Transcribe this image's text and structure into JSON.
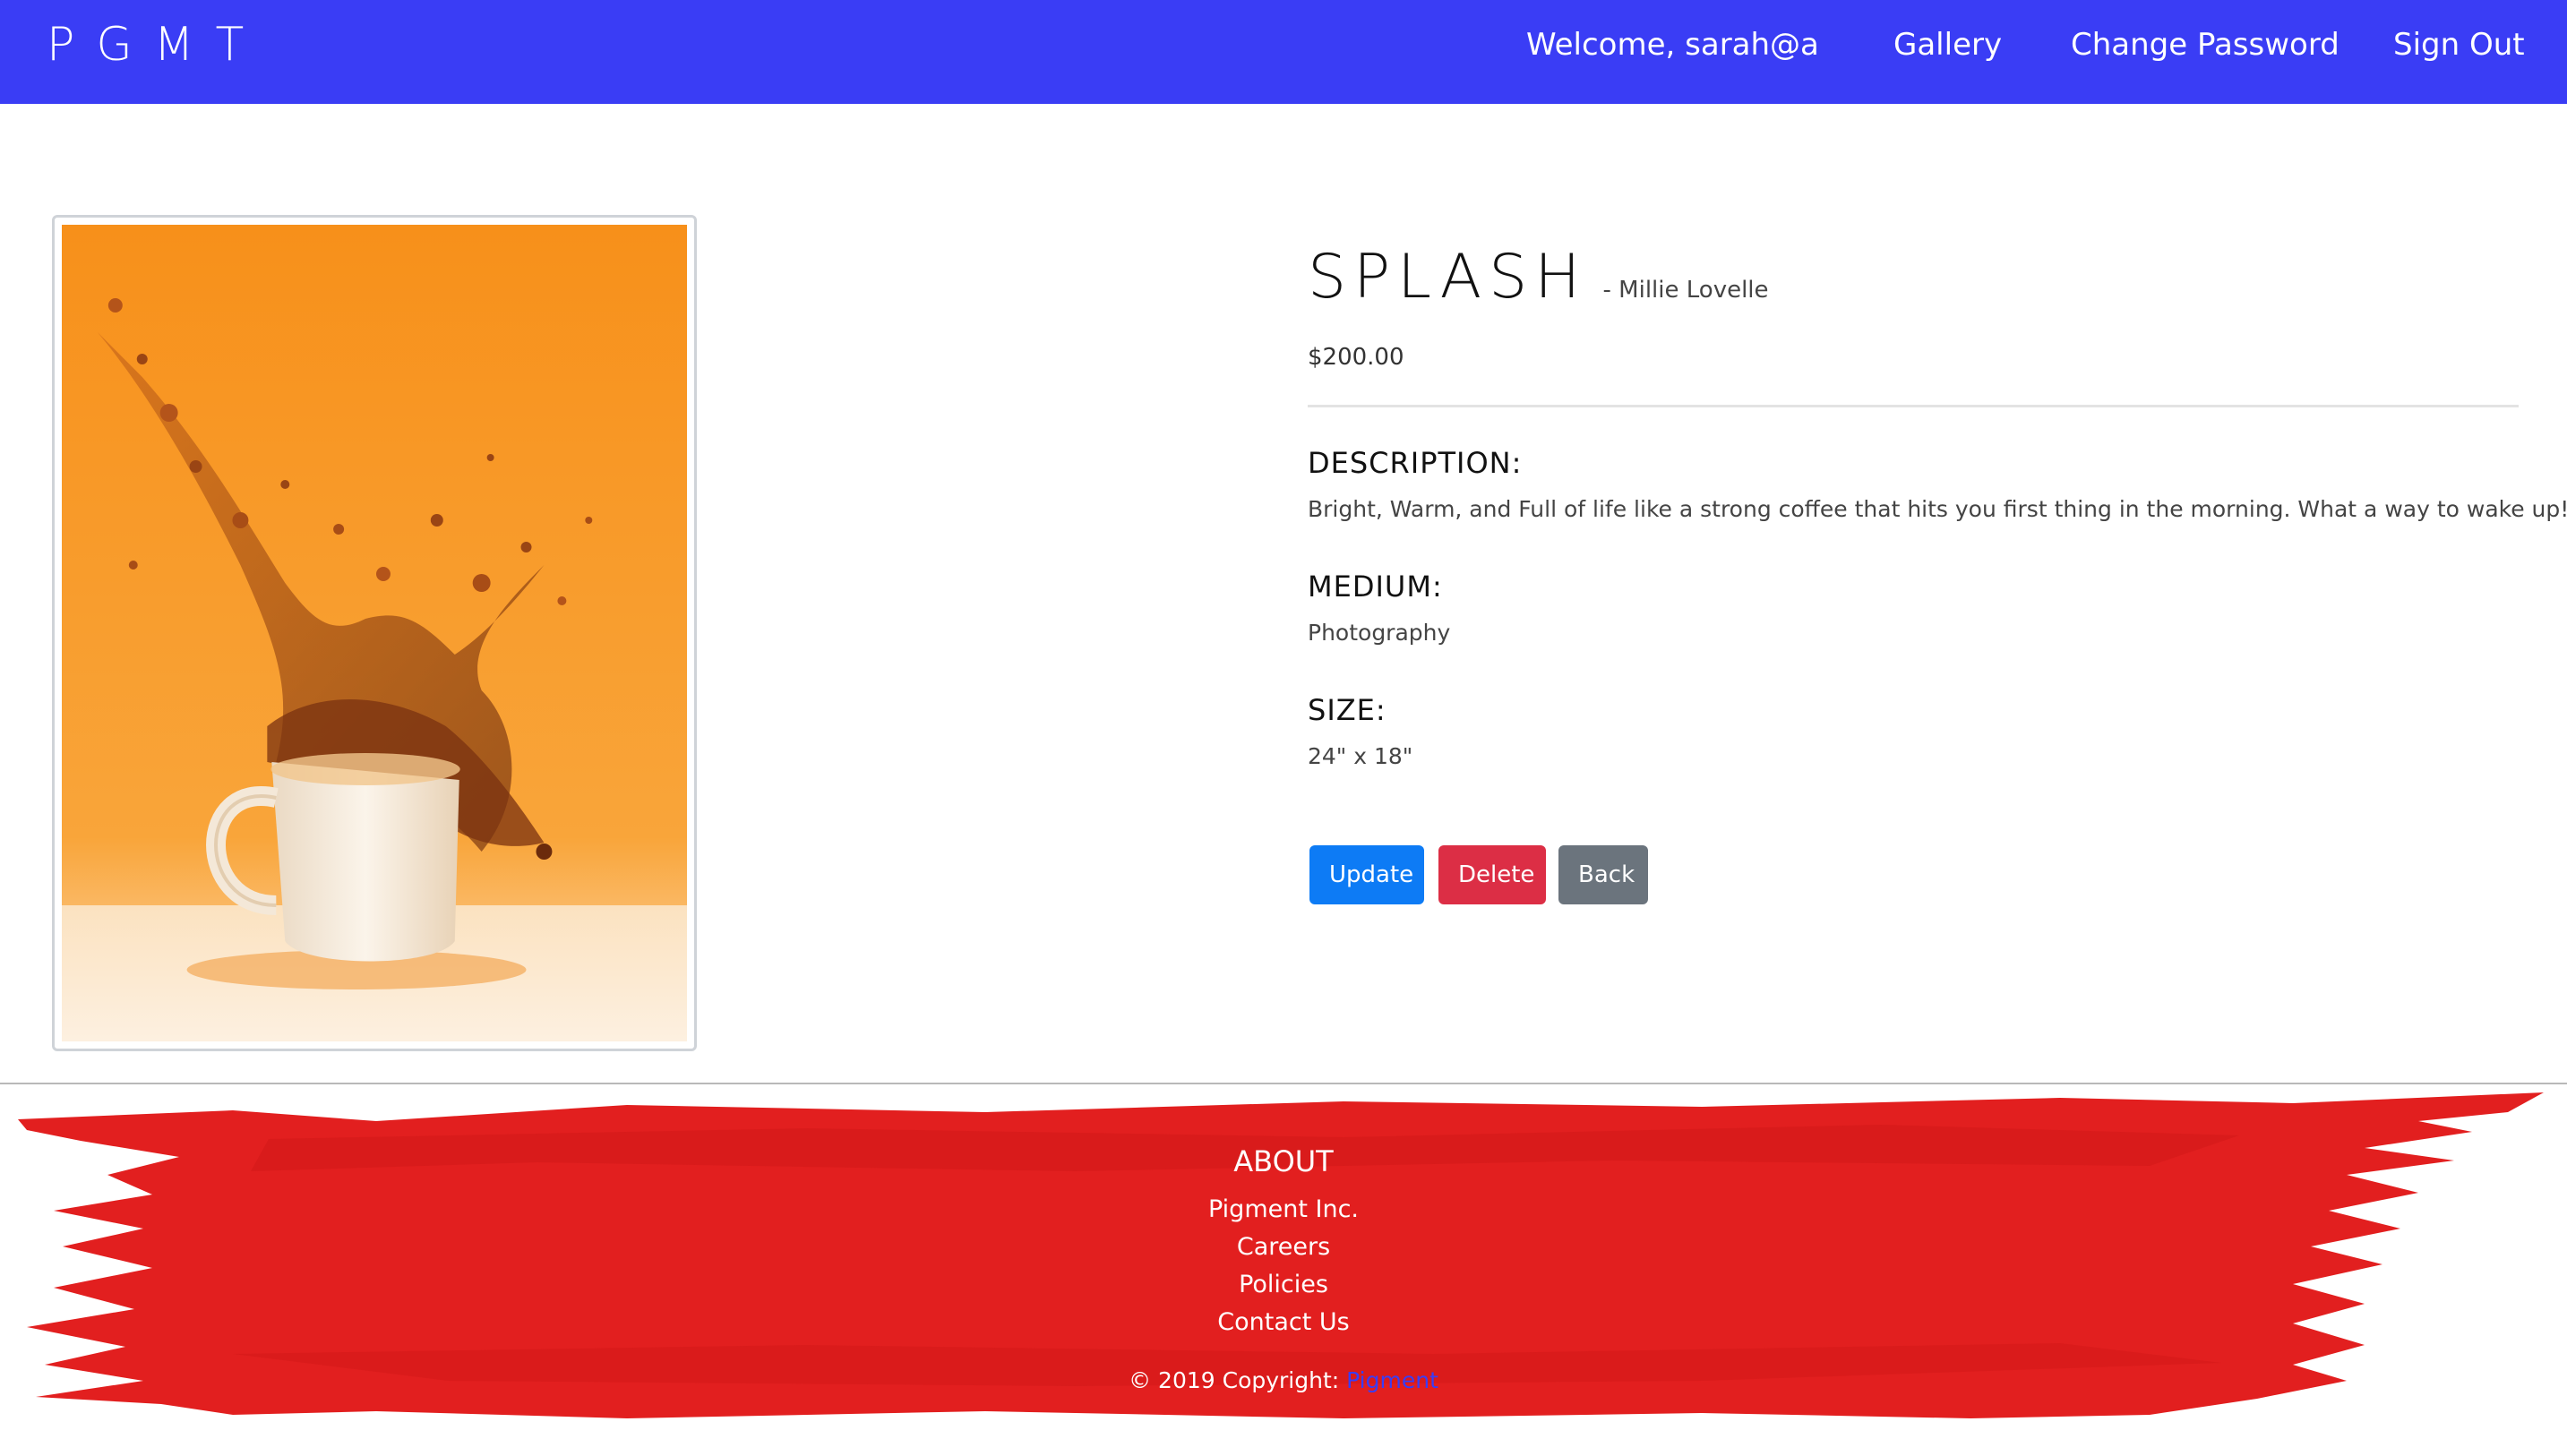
{
  "navbar": {
    "brand": "PGMT",
    "welcome": "Welcome, sarah@a",
    "gallery": "Gallery",
    "change_password": "Change Password",
    "sign_out": "Sign Out",
    "background_color": "#3a3df5"
  },
  "artwork": {
    "title": "SPLASH",
    "artist": "- Millie Lovelle",
    "price": "$200.00",
    "description_heading": "DESCRIPTION:",
    "description": "Bright, Warm, and Full of life like a strong coffee that hits you first thing in the morning. What a way to wake up!",
    "medium_heading": "MEDIUM:",
    "medium": "Photography",
    "size_heading": "SIZE:",
    "size": "24\" x 18\"",
    "image_icon": "coffee-splash-photo"
  },
  "actions": {
    "update": "Update",
    "delete": "Delete",
    "back": "Back",
    "colors": {
      "update": "#0d7bf5",
      "delete": "#dc2e45",
      "back": "#6b747d"
    }
  },
  "footer": {
    "heading": "ABOUT",
    "links": [
      "Pigment Inc.",
      "Careers",
      "Policies",
      "Contact Us"
    ],
    "copyright": "© 2019 Copyright:",
    "copyright_link": "Pigment",
    "paint_color": "#e41d1d"
  }
}
